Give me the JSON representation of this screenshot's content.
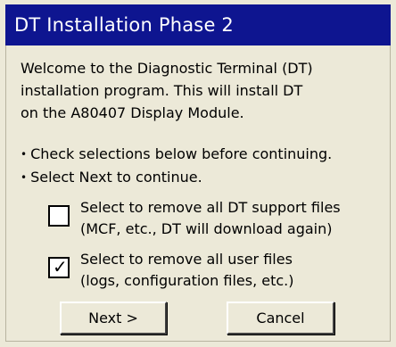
{
  "window": {
    "title": "DT Installation Phase 2"
  },
  "welcome": {
    "lines": [
      "Welcome to the Diagnostic Terminal (DT)",
      "installation program. This will install DT",
      "on the A80407 Display Module."
    ]
  },
  "instructions": [
    "Check selections below before continuing.",
    "Select Next to continue."
  ],
  "options": [
    {
      "checked": false,
      "lines": [
        "Select to remove all DT support files",
        "(MCF, etc., DT will download again)"
      ]
    },
    {
      "checked": true,
      "lines": [
        "Select to remove all user files",
        "(logs, configuration files, etc.)"
      ]
    }
  ],
  "buttons": {
    "next_label": "Next >",
    "cancel_label": "Cancel"
  },
  "colors": {
    "titlebar_bg": "#0e1590",
    "titlebar_text": "#ffffff",
    "dialog_bg": "#ece9d8"
  }
}
